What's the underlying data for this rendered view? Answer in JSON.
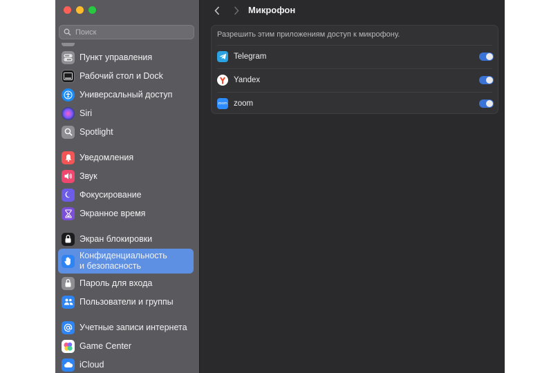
{
  "search": {
    "placeholder": "Поиск"
  },
  "sidebar": {
    "items": [
      {
        "label": "Пункт управления",
        "icon": "control-center-icon",
        "color": "#8e8e93"
      },
      {
        "label": "Рабочий стол и Dock",
        "icon": "desktop-dock-icon",
        "color": "#1c1c1e"
      },
      {
        "label": "Универсальный доступ",
        "icon": "accessibility-icon",
        "color": "#1b8af5"
      },
      {
        "label": "Siri",
        "icon": "siri-icon",
        "color": "#2b2b55"
      },
      {
        "label": "Spotlight",
        "icon": "spotlight-icon",
        "color": "#8e8e93"
      },
      {
        "label": "Уведомления",
        "icon": "notifications-icon",
        "color": "#f25555"
      },
      {
        "label": "Звук",
        "icon": "sound-icon",
        "color": "#f0476e"
      },
      {
        "label": "Фокусирование",
        "icon": "focus-icon",
        "color": "#6c5ce7"
      },
      {
        "label": "Экранное время",
        "icon": "screen-time-icon",
        "color": "#7b4fd8"
      },
      {
        "label": "Экран блокировки",
        "icon": "lock-screen-icon",
        "color": "#1c1c1e"
      },
      {
        "label_line1": "Конфиденциальность",
        "label_line2": "и безопасность",
        "icon": "privacy-hand-icon",
        "color": "#2f84f3",
        "selected": true
      },
      {
        "label": "Пароль для входа",
        "icon": "password-lock-icon",
        "color": "#8e8e93"
      },
      {
        "label": "Пользователи и группы",
        "icon": "users-groups-icon",
        "color": "#2f84f3"
      },
      {
        "label": "Учетные записи интернета",
        "icon": "internet-accounts-icon",
        "color": "#2f84f3"
      },
      {
        "label": "Game Center",
        "icon": "game-center-icon",
        "color": "#ffffff"
      },
      {
        "label": "iCloud",
        "icon": "icloud-icon",
        "color": "#2f84f3"
      }
    ]
  },
  "main": {
    "title": "Микрофон",
    "description": "Разрешить этим приложениям доступ к микрофону.",
    "apps": [
      {
        "name": "Telegram",
        "icon": "telegram-icon",
        "enabled": true
      },
      {
        "name": "Yandex",
        "icon": "yandex-icon",
        "enabled": true
      },
      {
        "name": "zoom",
        "icon": "zoom-icon",
        "icon_text": "zoom",
        "enabled": true
      }
    ]
  },
  "colors": {
    "accent": "#3a72d6",
    "selection": "#5d8fe3"
  }
}
